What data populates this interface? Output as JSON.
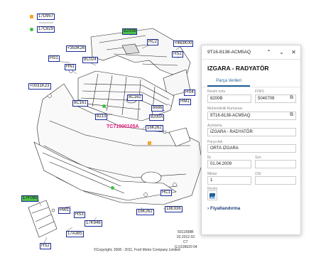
{
  "diagram": {
    "callouts": [
      {
        "id": "c0",
        "label": "17D957",
        "style": "blue"
      },
      {
        "id": "c1",
        "label": "17C829",
        "style": "blue"
      },
      {
        "id": "c2",
        "label": "8200B",
        "style": "green"
      },
      {
        "id": "c3",
        "label": "HC2",
        "style": "plain"
      },
      {
        "id": "c4",
        "label": "<463K00",
        "style": "blue"
      },
      {
        "id": "c5",
        "label": "<353K26",
        "style": "blue"
      },
      {
        "id": "c6",
        "label": "HS1",
        "style": "plain"
      },
      {
        "id": "c7",
        "label": "8C024",
        "style": "plain"
      },
      {
        "id": "c8",
        "label": "HS2",
        "style": "plain"
      },
      {
        "id": "c9",
        "label": "HN1",
        "style": "plain"
      },
      {
        "id": "c10",
        "label": "<0031K23",
        "style": "blue"
      },
      {
        "id": "c11",
        "label": "HS4",
        "style": "plain"
      },
      {
        "id": "c12",
        "label": "8C162",
        "style": "plain"
      },
      {
        "id": "c13",
        "label": "HM1",
        "style": "plain"
      },
      {
        "id": "c14",
        "label": "8C161",
        "style": "plain"
      },
      {
        "id": "c15",
        "label": "8686",
        "style": "blue"
      },
      {
        "id": "c16",
        "label": "8213",
        "style": "plain"
      },
      {
        "id": "c17",
        "label": "8200A",
        "style": "plain"
      },
      {
        "id": "c18",
        "label": "16K262",
        "style": "plain"
      },
      {
        "id": "c19",
        "label": "HC1",
        "style": "plain"
      },
      {
        "id": "c20",
        "label": "17F095",
        "style": "green"
      },
      {
        "id": "c21",
        "label": "HW1",
        "style": "plain"
      },
      {
        "id": "c22",
        "label": "HS3",
        "style": "plain"
      },
      {
        "id": "c23",
        "label": "16K262",
        "style": "plain"
      },
      {
        "id": "c24",
        "label": "18E936",
        "style": "blue"
      },
      {
        "id": "c25",
        "label": "17K946",
        "style": "blue"
      },
      {
        "id": "c26",
        "label": "17A385",
        "style": "plain"
      },
      {
        "id": "c27",
        "label": "HS2",
        "style": "plain"
      }
    ],
    "highlight_label": "TC71000105A",
    "copyright": "©Copyright, 2008 - 2011, Ford Motor Company Limited",
    "code_lines": [
      "5011998B",
      "02.2012.03",
      "C7",
      "G.0199620 04"
    ],
    "colors": {
      "legend_square": "#f5a52a",
      "legend_dot": "#3fbf3f",
      "highlight": "#e0187a"
    }
  },
  "panel": {
    "part_number": "9T16-8138-ACM5AQ",
    "title": "IZGARA - RADYATÖR",
    "tab": "Parça Verileri",
    "fields": [
      {
        "label": "Resim notu",
        "value": "8200B"
      },
      {
        "label": "FINIS",
        "value": "5040709"
      },
      {
        "label": "Mühendislik Numarası",
        "value": "9T16-8138-ACM5AQ"
      },
      {
        "label": "Açıklama",
        "value": "IZGARA - RADYATÖR"
      },
      {
        "label": "Parça Adı",
        "value": "ORTA IZGARA"
      },
      {
        "label": "İlk",
        "value": "01.04.2009"
      },
      {
        "label": "Son",
        "value": ""
      },
      {
        "label": "Miktar",
        "value": "1"
      },
      {
        "label": "OSI",
        "value": ""
      },
      {
        "label": "Resim",
        "value": ""
      }
    ],
    "prices": "Fiyatlandırma",
    "icons": [
      "chevron-up-icon",
      "chevron-down-icon",
      "close-icon",
      "copy-icon",
      "image-icon",
      "chevron-right-icon"
    ]
  }
}
